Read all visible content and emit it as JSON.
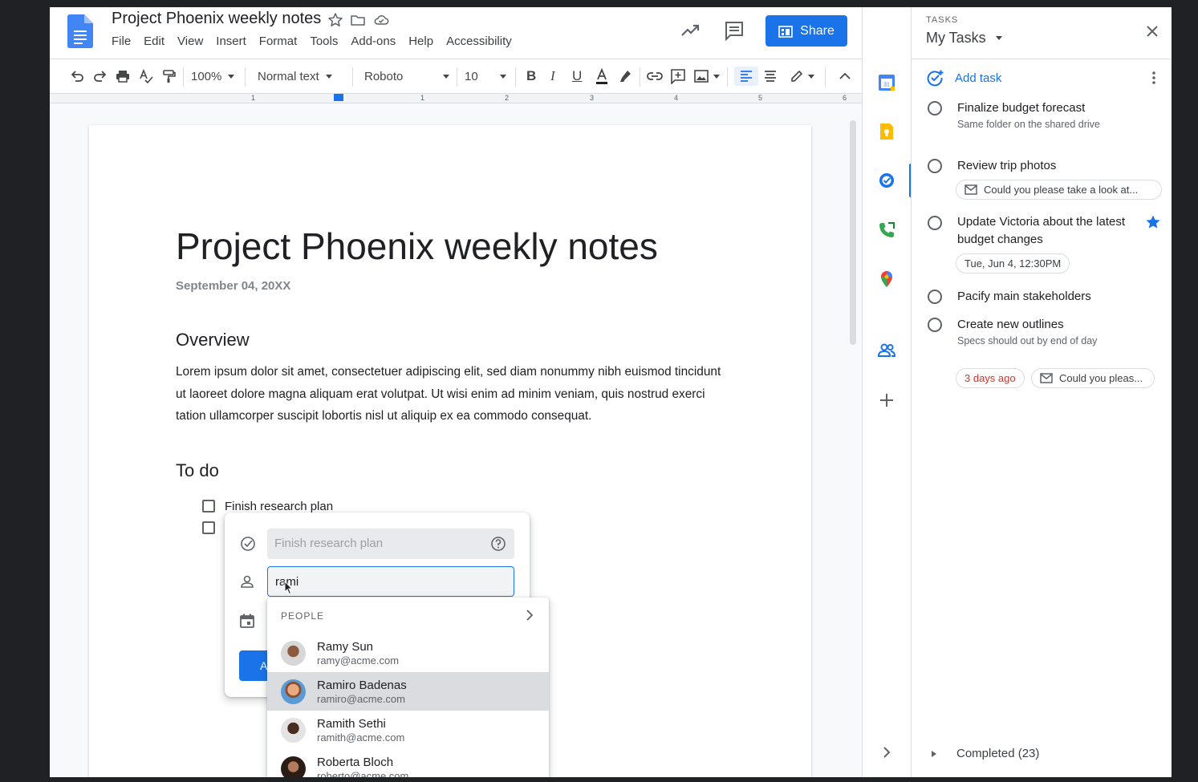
{
  "document": {
    "title": "Project Phoenix weekly notes"
  },
  "menu": [
    "File",
    "Edit",
    "View",
    "Insert",
    "Format",
    "Tools",
    "Add-ons",
    "Help",
    "Accessibility"
  ],
  "share_label": "Share",
  "toolbar": {
    "zoom": "100%",
    "style": "Normal text",
    "font": "Roboto",
    "font_size": "10"
  },
  "ruler_numbers": [
    "1",
    "1",
    "2",
    "3",
    "4",
    "5",
    "6"
  ],
  "page": {
    "title": "Project Phoenix weekly notes",
    "date": "September 04, 20XX",
    "overview_heading": "Overview",
    "overview_body": "Lorem ipsum dolor sit amet, consectetuer adipiscing elit, sed diam nonummy nibh euismod tincidunt ut laoreet dolore magna aliquam erat volutpat. Ut wisi enim ad minim veniam, quis nostrud exerci tation ullamcorper suscipit lobortis nisl ut aliquip ex ea commodo consequat.",
    "todo_heading": "To do",
    "todo_items": [
      "Finish research plan",
      ""
    ]
  },
  "assign_popup": {
    "task_name": "Finish research plan",
    "assignee_query": "rami",
    "assign_button_label": "A"
  },
  "people_dropdown": {
    "header": "PEOPLE",
    "people": [
      {
        "name": "Ramy Sun",
        "email": "ramy@acme.com"
      },
      {
        "name": "Ramiro Badenas",
        "email": "ramiro@acme.com"
      },
      {
        "name": "Ramith Sethi",
        "email": "ramith@acme.com"
      },
      {
        "name": "Roberta Bloch",
        "email": "roberto@acme.com"
      }
    ],
    "highlighted_index": 1
  },
  "tasks_panel": {
    "caption": "TASKS",
    "list_title": "My Tasks",
    "add_task_label": "Add task",
    "tasks": [
      {
        "title": "Finalize budget forecast",
        "notes": "Same folder on the shared drive"
      },
      {
        "title": "Review trip photos",
        "chip": "Could you please take a look at..."
      },
      {
        "title": "Update Victoria about the latest budget changes",
        "chip": "Tue, Jun 4, 12:30PM",
        "starred": true
      },
      {
        "title": "Pacify main stakeholders"
      },
      {
        "title": "Create new outlines",
        "notes": "Specs should out by end of day",
        "due_chip": "3 days ago",
        "chip": "Could you pleas..."
      }
    ],
    "completed_label": "Completed (23)"
  },
  "colors": {
    "accent": "#1a73e8",
    "overdue": "#d93025"
  }
}
